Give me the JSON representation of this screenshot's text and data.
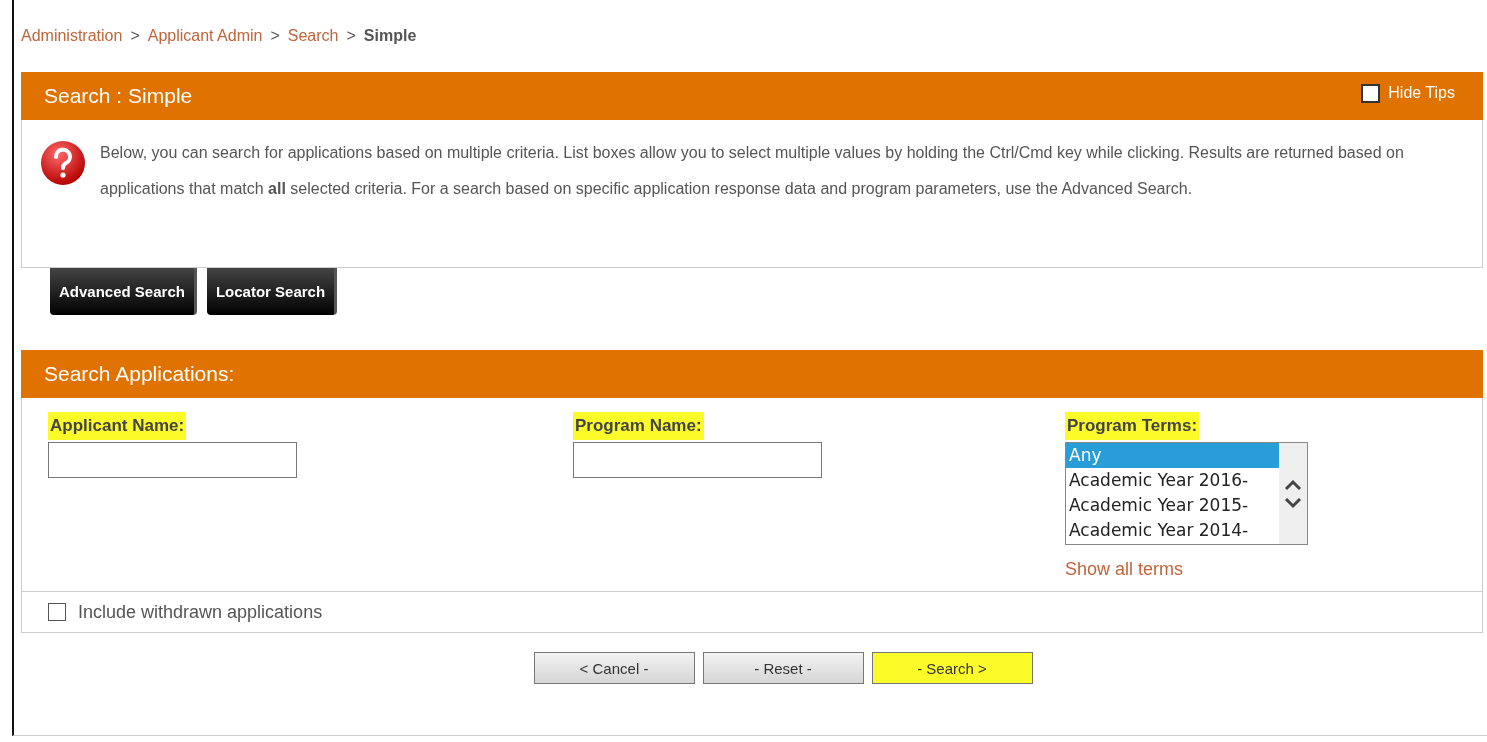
{
  "breadcrumb": [
    {
      "label": "Administration",
      "current": false
    },
    {
      "label": "Applicant Admin",
      "current": false
    },
    {
      "label": "Search",
      "current": false
    },
    {
      "label": "Simple",
      "current": true
    }
  ],
  "breadcrumb_separator": ">",
  "tips_panel": {
    "title": "Search : Simple",
    "hide_tips": {
      "label": "Hide Tips",
      "checked": false
    },
    "text": "Below, you can search for applications based on multiple criteria. List boxes allow you to select multiple values by holding the Ctrl/Cmd key while clicking. Results are returned based on applications that match **all** selected criteria. For a search based on specific application response data and program parameters, use the Advanced Search."
  },
  "search_types": [
    "Advanced Search",
    "Locator Search"
  ],
  "search_panel": {
    "title": "Search Applications:",
    "fields": [
      {
        "kind": "text",
        "label": "Applicant Name:",
        "highlighted": true
      },
      {
        "kind": "text",
        "label": "Program Name:",
        "highlighted": true
      },
      {
        "kind": "list",
        "label": "Program Terms:",
        "highlighted": true,
        "options": [
          {
            "label": "Any",
            "selected": true
          },
          {
            "label": "Academic Year 2016-",
            "selected": false
          },
          {
            "label": "Academic Year 2015-",
            "selected": false
          },
          {
            "label": "Academic Year 2014-",
            "selected": false
          }
        ],
        "link": "Show all terms"
      }
    ],
    "include_withdrawn": {
      "label": "Include withdrawn applications",
      "checked": false
    }
  },
  "actions": [
    {
      "label": "< Cancel -",
      "highlighted": false
    },
    {
      "label": "- Reset -",
      "highlighted": false
    },
    {
      "label": "- Search >",
      "highlighted": true
    }
  ]
}
